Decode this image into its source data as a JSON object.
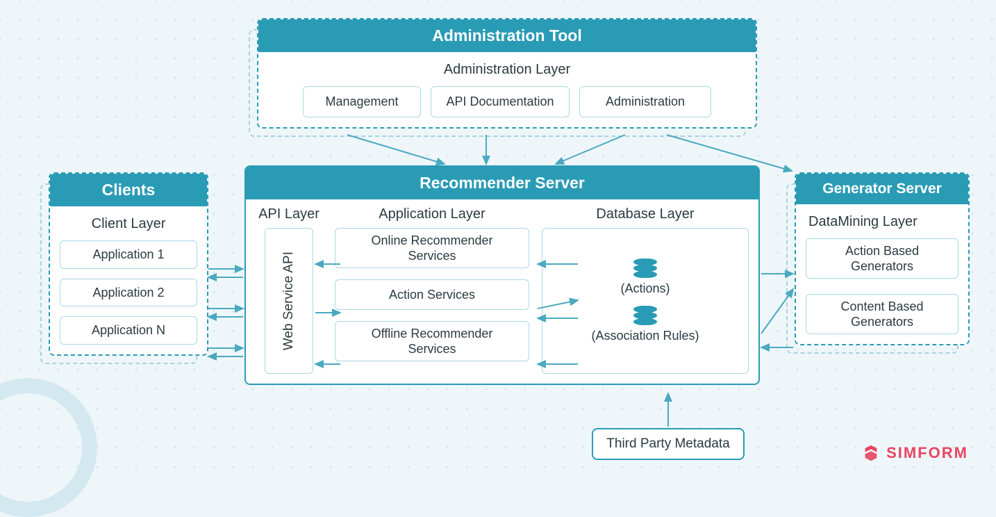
{
  "admin_tool": {
    "title": "Administration Tool",
    "layer": "Administration Layer",
    "items": [
      "Management",
      "API Documentation",
      "Administration"
    ]
  },
  "clients": {
    "title": "Clients",
    "layer": "Client Layer",
    "apps": [
      "Application 1",
      "Application 2",
      "Application N"
    ]
  },
  "recommender": {
    "title": "Recommender Server",
    "columns": {
      "api": {
        "title": "API Layer",
        "item": "Web Service API"
      },
      "app": {
        "title": "Application Layer",
        "items": [
          "Online Recommender Services",
          "Action Services",
          "Offline Recommender Services"
        ]
      },
      "db": {
        "title": "Database Layer",
        "items": [
          "(Actions)",
          "(Association Rules)"
        ]
      }
    }
  },
  "generator": {
    "title": "Generator Server",
    "layer": "DataMining Layer",
    "items": [
      "Action Based Generators",
      "Content Based Generators"
    ]
  },
  "third_party": "Third Party Metadata",
  "brand": "SIMFORM",
  "colors": {
    "accent": "#2a9bb5",
    "brand": "#e84560",
    "bg": "#eef6fa"
  }
}
